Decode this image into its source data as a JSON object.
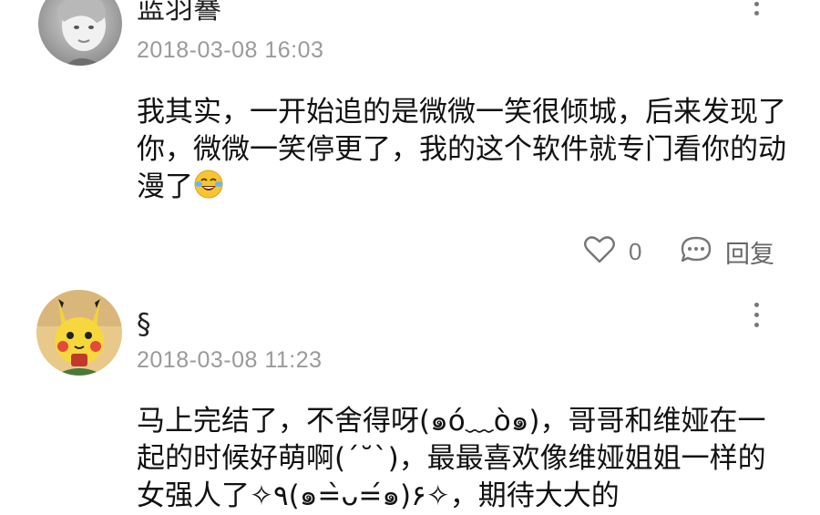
{
  "comments": [
    {
      "username": "蓝羽謈",
      "timestamp": "2018-03-08 16:03",
      "text": "我其实，一开始追的是微微一笑很倾城，后来发现了你，微微一笑停更了，我的这个软件就专门看你的动漫了",
      "emoji": "crying-laughing-emoji",
      "likes": "0",
      "reply_label": "回复"
    },
    {
      "username": "§",
      "timestamp": "2018-03-08 11:23",
      "text": "马上完结了，不舍得呀(๑ó﹏ò๑)，哥哥和维娅在一起的时候好萌啊(ˊ˘ˋ)，最最喜欢像维娅姐姐一样的女强人了✧٩(๑=̀ᴗ=́๑)۶✧，期待大大的"
    }
  ],
  "colors": {
    "timestamp": "#9a9a9a",
    "icon": "#777777",
    "text": "#111111"
  }
}
